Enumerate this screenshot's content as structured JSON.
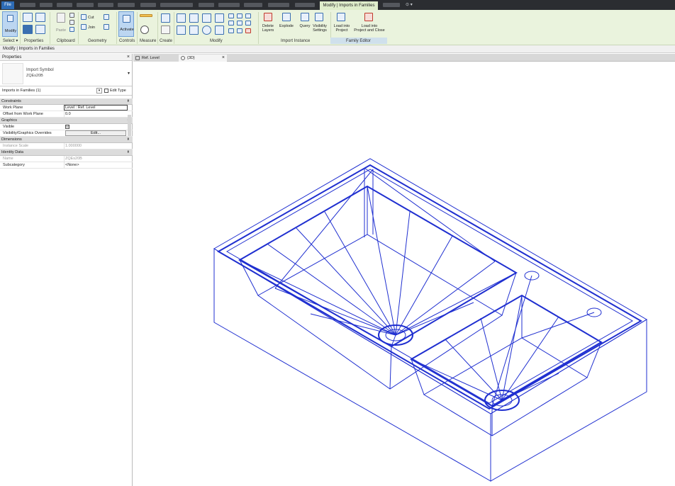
{
  "tabs": {
    "file": "File",
    "active": "Modify | Imports in Families",
    "extra": "⊙ ▾"
  },
  "ribbon": {
    "modify_btn": "Modify",
    "cut": "Cut",
    "join": "Join",
    "paste": "Paste",
    "activate": "Activate",
    "delete_layers": "Delete\nLayers",
    "explode": "Explode",
    "query": "Query",
    "visibility_settings": "Visibility\nSettings",
    "load_into_project": "Load into\nProject",
    "load_into_project_close": "Load into\nProject and Close",
    "panels": {
      "select": "Select ▾",
      "properties": "Properties",
      "clipboard": "Clipboard",
      "geometry": "Geometry",
      "controls": "Controls",
      "measure": "Measure",
      "create": "Create",
      "modify": "Modify",
      "import_instance": "Import Instance",
      "family_editor": "Family Editor"
    }
  },
  "options_bar": {
    "text": "Modify | Imports in Families"
  },
  "view_tabs": [
    {
      "label": "Ref. Level",
      "close": "×"
    },
    {
      "label": "{3D}",
      "close": "×"
    }
  ],
  "properties": {
    "title": "Properties",
    "close": "×",
    "type_line1": "Import Symbol",
    "type_line2": "ZQEs20B",
    "instance_filter": "Imports in Families (1)",
    "edit_type": "Edit Type",
    "groups": {
      "constraints": "Constraints",
      "graphics": "Graphics",
      "dimensions": "Dimensions",
      "identity": "Identity Data"
    },
    "rows": {
      "work_plane": {
        "name": "Work Plane",
        "value": "Level : Ref. Level"
      },
      "offset": {
        "name": "Offset from Work Plane",
        "value": "0.0"
      },
      "visible": {
        "name": "Visible",
        "value": "☑"
      },
      "vg_overrides": {
        "name": "Visibility/Graphics Overrides",
        "value": "Edit..."
      },
      "instance_scale": {
        "name": "Instance Scale",
        "value": "1.000000"
      },
      "name": {
        "name": "Name",
        "value": "ZQEs20B"
      },
      "subcategory": {
        "name": "Subcategory",
        "value": "<None>"
      }
    }
  },
  "colors": {
    "wire": "#1f2fd0",
    "ribbon": "#eaf3dd",
    "file_tab": "#2d6bb5"
  }
}
